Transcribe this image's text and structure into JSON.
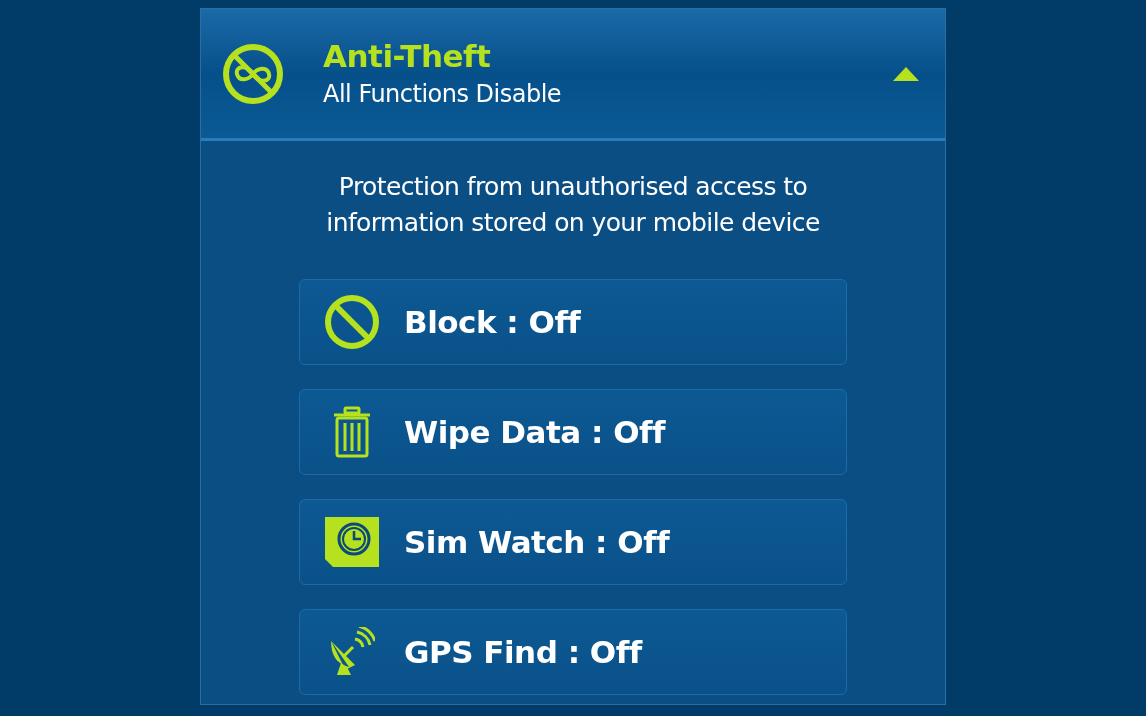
{
  "section": {
    "title": "Anti-Theft",
    "subtitle": "All Functions Disable",
    "expanded": true
  },
  "description": "Protection from unauthorised access to information stored on your mobile device",
  "features": [
    {
      "kind": "block",
      "label": "Block : Off"
    },
    {
      "kind": "wipe",
      "label": "Wipe Data : Off"
    },
    {
      "kind": "simwatch",
      "label": "Sim Watch : Off"
    },
    {
      "kind": "gps",
      "label": "GPS Find : Off"
    }
  ]
}
